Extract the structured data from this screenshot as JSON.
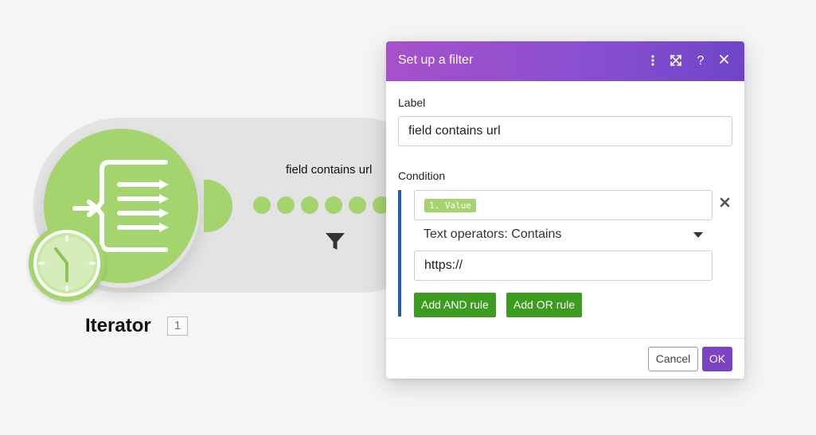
{
  "module": {
    "title": "Iterator",
    "count": "1",
    "icon": "iterator-icon",
    "badge_icon": "clock-icon",
    "accent": "#a4d46e"
  },
  "route": {
    "label": "field contains url",
    "filter_icon": "funnel-icon"
  },
  "dialog": {
    "title": "Set up a filter",
    "header_gradient": [
      "#a651c9",
      "#6f45c8"
    ],
    "label_heading": "Label",
    "label_value": "field contains url",
    "condition_heading": "Condition",
    "condition": {
      "value_token": "1. Value",
      "operator": "Text operators: Contains",
      "operand": "https://"
    },
    "add_and_label": "Add AND rule",
    "add_or_label": "Add OR rule",
    "cancel_label": "Cancel",
    "ok_label": "OK"
  },
  "colors": {
    "ok_button": "#7a44c2",
    "rule_button": "#3c9c1f",
    "condition_bar": "#1e63a8"
  }
}
